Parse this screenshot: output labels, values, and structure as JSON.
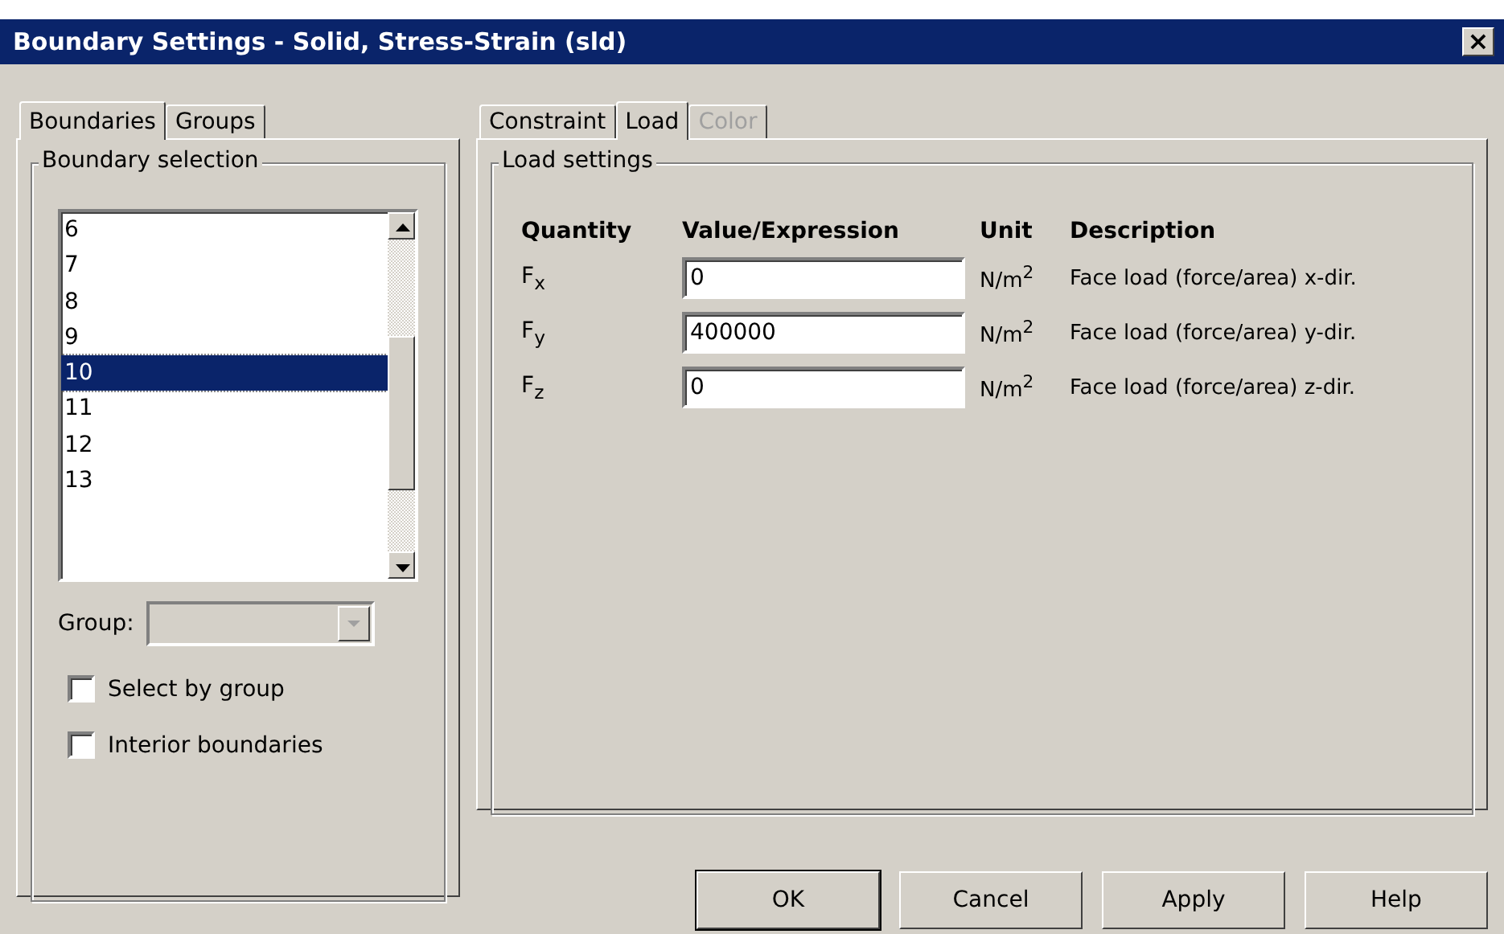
{
  "window": {
    "title": "Boundary Settings - Solid, Stress-Strain (sld)",
    "close": "×"
  },
  "left_tabs": [
    {
      "label": "Boundaries",
      "selected": true
    },
    {
      "label": "Groups",
      "selected": false
    }
  ],
  "boundary_selection": {
    "title": "Boundary selection",
    "items": [
      {
        "label": "6",
        "selected": false
      },
      {
        "label": "7",
        "selected": false
      },
      {
        "label": "8",
        "selected": false
      },
      {
        "label": "9",
        "selected": false
      },
      {
        "label": "10",
        "selected": true
      },
      {
        "label": "11",
        "selected": false
      },
      {
        "label": "12",
        "selected": false
      },
      {
        "label": "13",
        "selected": false
      }
    ],
    "group_label": "Group:",
    "group_disabled": true,
    "checkboxes": [
      {
        "label": "Select by group",
        "checked": false
      },
      {
        "label": "Interior boundaries",
        "checked": false
      }
    ]
  },
  "right_tabs": [
    {
      "label": "Constraint",
      "selected": false,
      "disabled": false
    },
    {
      "label": "Load",
      "selected": true,
      "disabled": false
    },
    {
      "label": "Color",
      "selected": false,
      "disabled": true
    }
  ],
  "load_settings": {
    "title": "Load settings",
    "columns": [
      "Quantity",
      "Value/Expression",
      "Unit",
      "Description"
    ],
    "rows": [
      {
        "quantity": "F$_{x}$",
        "value": "0",
        "unit": "N/m$^{2}$",
        "description": "Face load (force/area) x-dir."
      },
      {
        "quantity": "F$_{y}$",
        "value": "400000",
        "unit": "N/m$^{2}$",
        "description": "Face load (force/area) y-dir."
      },
      {
        "quantity": "F$_{z}$",
        "value": "0",
        "unit": "N/m$^{2}$",
        "description": "Face load (force/area) z-dir."
      }
    ]
  },
  "buttons": [
    {
      "label": "OK",
      "default": true
    },
    {
      "label": "Cancel",
      "default": false
    },
    {
      "label": "Apply",
      "default": false
    },
    {
      "label": "Help",
      "default": false
    }
  ]
}
